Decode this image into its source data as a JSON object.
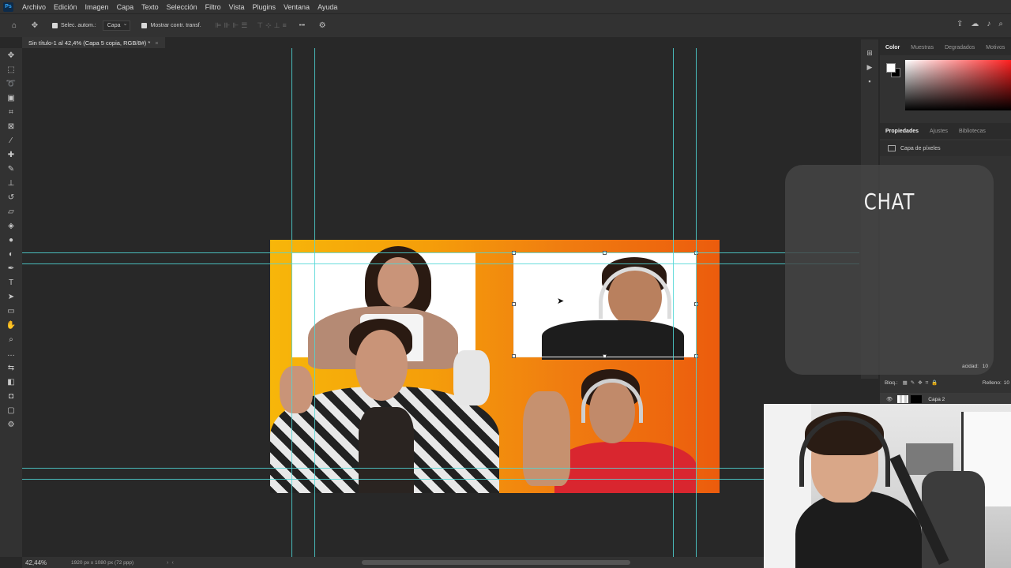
{
  "menubar": {
    "logo": "Ps",
    "items": [
      "Archivo",
      "Edición",
      "Imagen",
      "Capa",
      "Texto",
      "Selección",
      "Filtro",
      "Vista",
      "Plugins",
      "Ventana",
      "Ayuda"
    ]
  },
  "optionsbar": {
    "auto_select_label": "Selec. autom.:",
    "auto_select_target": "Capa",
    "transform_controls_label": "Mostrar contr. transf.",
    "more_label": "•••"
  },
  "document": {
    "tab_title": "Sin título-1 al 42,4% (Capa 5 copia, RGB/8#) *",
    "close_glyph": "×"
  },
  "right_panels": {
    "color_tabs": [
      "Color",
      "Muestras",
      "Degradados",
      "Motivos"
    ],
    "properties_tabs": [
      "Propiedades",
      "Ajustes",
      "Bibliotecas"
    ],
    "pixel_layer_label": "Capa de píxeles"
  },
  "overlay": {
    "chat_title": "CHAT"
  },
  "layers": {
    "lock_label": "Bloq.:",
    "fill_label": "Relleno:",
    "fill_value": "10",
    "opacity_label": "acidad:",
    "opacity_value": "10",
    "layer_name": "Capa 2"
  },
  "statusbar": {
    "zoom": "42,44%",
    "doc_size": "1920 px x 1080 px (72 ppp)"
  },
  "colors": {
    "guide": "#4fd6d6",
    "gradient_start": "#f7b60a",
    "gradient_end": "#ec5c0d",
    "ui_dark": "#323232"
  }
}
